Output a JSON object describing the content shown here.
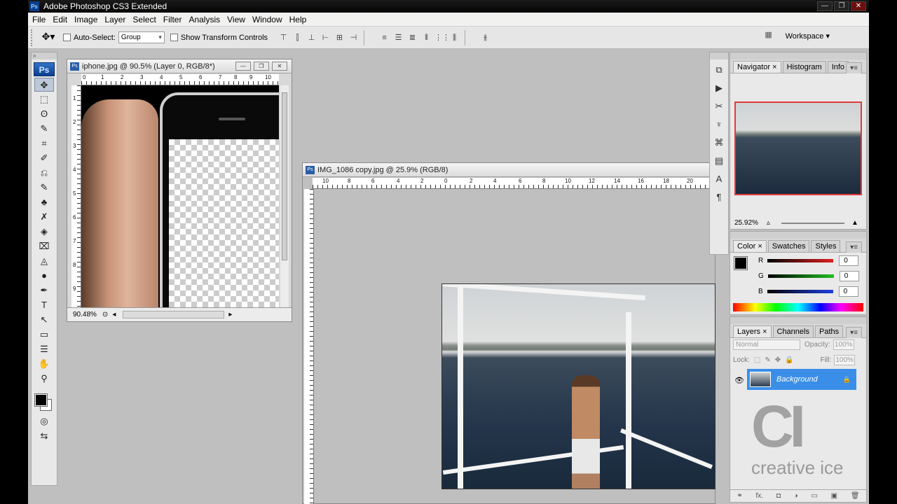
{
  "app": {
    "title": "Adobe Photoshop CS3 Extended",
    "logo": "Ps",
    "window_buttons": [
      "—",
      "❐",
      "✕"
    ]
  },
  "menu": [
    "File",
    "Edit",
    "Image",
    "Layer",
    "Select",
    "Filter",
    "Analysis",
    "View",
    "Window",
    "Help"
  ],
  "options": {
    "auto_select_label": "Auto-Select:",
    "auto_select_value": "Group",
    "show_transform_label": "Show Transform Controls",
    "workspace_label": "Workspace ▾"
  },
  "tools": [
    "✥",
    "⬚",
    "ʘ",
    "✎",
    "⌗",
    "✐",
    "⎌",
    "✎",
    "♣",
    "✗",
    "◈",
    "⌧",
    "◬",
    "●",
    "✒",
    "T",
    "↖",
    "▭",
    "☰",
    "✋",
    "⚲",
    "◎",
    "⇆"
  ],
  "doc1": {
    "title": "iphone.jpg @ 90.5% (Layer 0, RGB/8*)",
    "zoom": "90.48%",
    "ruler_top": [
      "0",
      "1",
      "2",
      "3",
      "4",
      "5",
      "6",
      "7",
      "8",
      "9",
      "10"
    ],
    "ruler_left": [
      "1",
      "2",
      "3",
      "4",
      "5",
      "6",
      "7",
      "8",
      "9"
    ]
  },
  "doc2": {
    "title": "IMG_1086 copy.jpg @ 25.9% (RGB/8)",
    "ruler_top": [
      "10",
      "8",
      "6",
      "4",
      "2",
      "0",
      "2",
      "4",
      "6",
      "8",
      "10",
      "12",
      "14",
      "16",
      "18",
      "20"
    ]
  },
  "navigator": {
    "tabs": [
      "Navigator ×",
      "Histogram",
      "Info"
    ],
    "zoom": "25.92%"
  },
  "color": {
    "tabs": [
      "Color ×",
      "Swatches",
      "Styles"
    ],
    "channels": [
      {
        "label": "R",
        "value": "0",
        "color": "#e02020"
      },
      {
        "label": "G",
        "value": "0",
        "color": "#20c020"
      },
      {
        "label": "B",
        "value": "0",
        "color": "#2040e0"
      }
    ]
  },
  "layers": {
    "tabs": [
      "Layers ×",
      "Channels",
      "Paths"
    ],
    "blend": "Normal",
    "opacity_label": "Opacity:",
    "opacity": "100%",
    "lock_label": "Lock:",
    "fill_label": "Fill:",
    "fill": "100%",
    "layer_name": "Background",
    "footer_icons": [
      "⚭",
      "fx.",
      "◘",
      "◑",
      "▭",
      "▣",
      "🗑"
    ]
  },
  "watermark": {
    "logo": "CI",
    "text": "creative ice"
  }
}
